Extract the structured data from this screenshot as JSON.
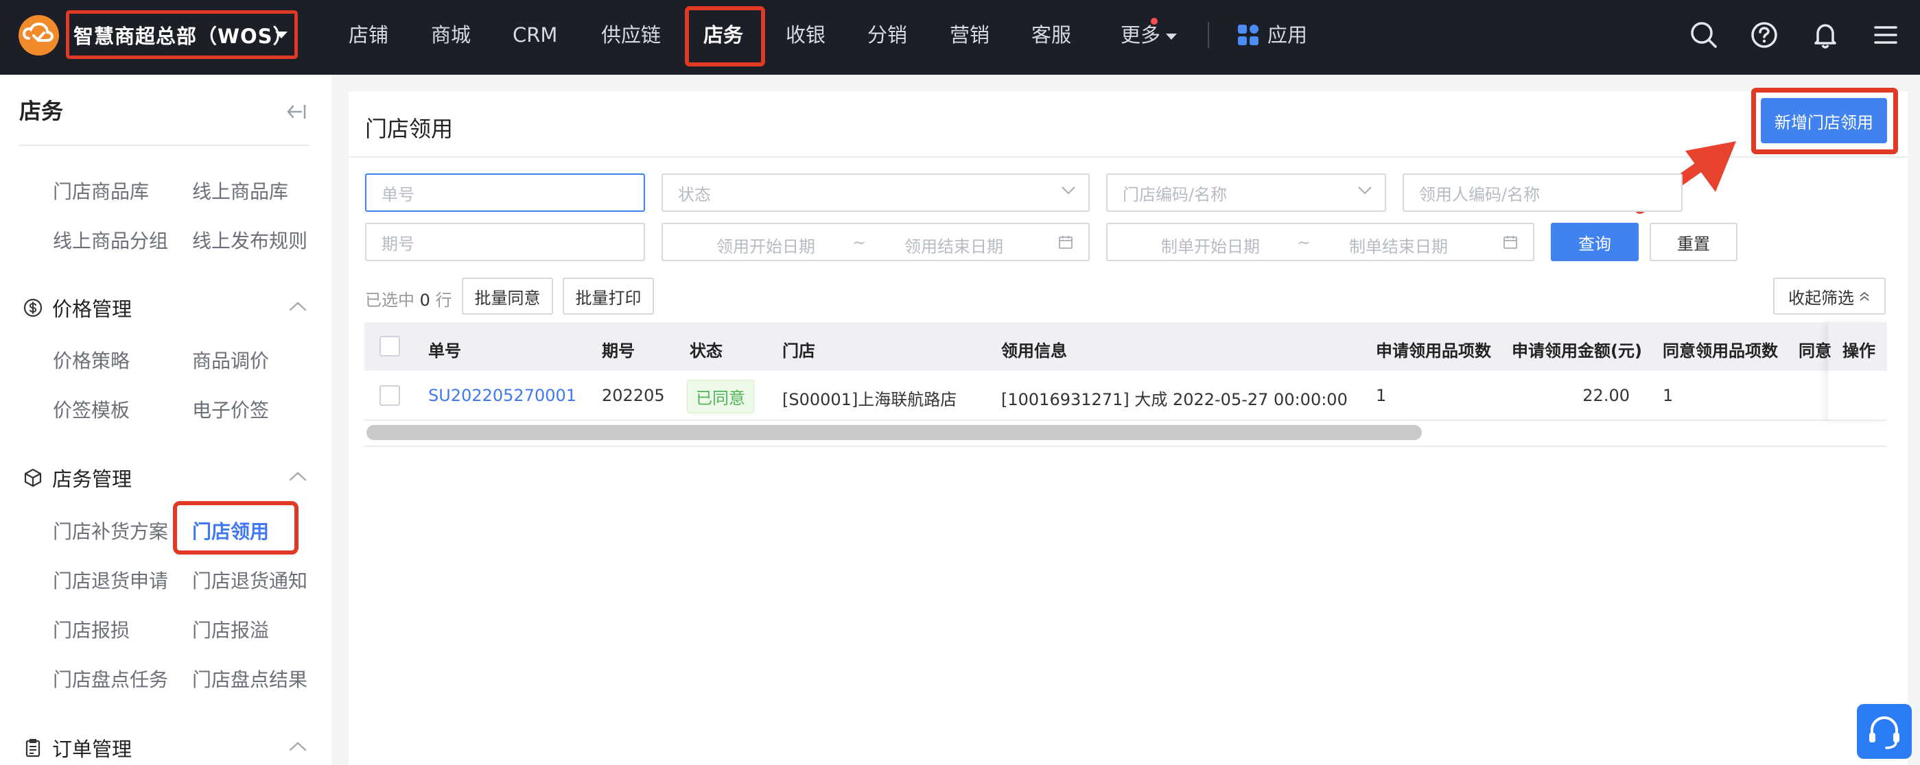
{
  "app": {
    "brand": "智慧商超总部（WOS）"
  },
  "nav": {
    "items": [
      "店铺",
      "商城",
      "CRM",
      "供应链",
      "店务",
      "收银",
      "分销",
      "营销",
      "客服",
      "更多",
      "应用"
    ],
    "active": "店务"
  },
  "sidebar": {
    "title": "店务",
    "top_links": [
      "门店商品库",
      "线上商品库",
      "线上商品分组",
      "线上发布规则"
    ],
    "sections": [
      {
        "label": "价格管理",
        "items": [
          "价格策略",
          "商品调价",
          "价签模板",
          "电子价签"
        ]
      },
      {
        "label": "店务管理",
        "items": [
          "门店补货方案",
          "门店领用",
          "门店退货申请",
          "门店退货通知",
          "门店报损",
          "门店报溢",
          "门店盘点任务",
          "门店盘点结果"
        ]
      },
      {
        "label": "订单管理",
        "items": []
      }
    ]
  },
  "page": {
    "title": "门店领用",
    "add_button": "新增门店领用"
  },
  "filters": {
    "order_no": "单号",
    "status": "状态",
    "store": "门店编码/名称",
    "requester": "领用人编码/名称",
    "period": "期号",
    "use_start": "领用开始日期",
    "use_end": "领用结束日期",
    "tilde": "~",
    "make_start": "制单开始日期",
    "make_end": "制单结束日期",
    "query": "查询",
    "reset": "重置",
    "collapse": "收起筛选"
  },
  "selection": {
    "prefix": "已选中",
    "count": "0",
    "suffix": "行",
    "batch_agree": "批量同意",
    "batch_print": "批量打印"
  },
  "table": {
    "columns": [
      "单号",
      "期号",
      "状态",
      "门店",
      "领用信息",
      "申请领用品项数",
      "申请领用金额(元)",
      "同意领用品项数",
      "同意",
      "操作"
    ],
    "rows": [
      {
        "order_no": "SU202205270001",
        "period": "202205",
        "status": "已同意",
        "store": "[S00001]上海联航路店",
        "info": "[10016931271] 大成 2022-05-27 00:00:00",
        "req_items": "1",
        "req_amount": "22.00",
        "agree_items": "1",
        "agree": "",
        "ops": ""
      }
    ]
  },
  "colors": {
    "accent": "#3f82f0",
    "highlight": "#e03a25",
    "topbar": "#1c1f27",
    "success": "#52b45a"
  }
}
